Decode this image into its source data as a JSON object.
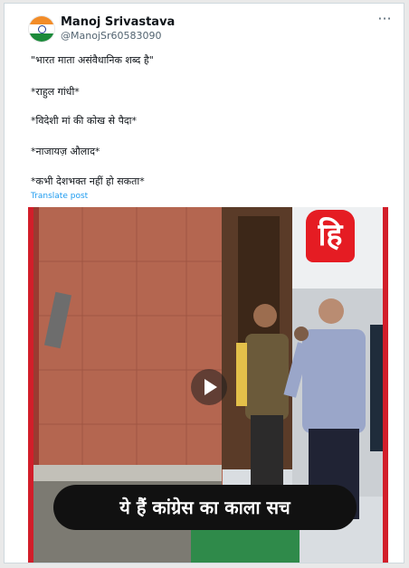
{
  "post": {
    "author_name": "Manoj Srivastava",
    "author_handle": "@ManojSr60583090",
    "lines": [
      "\"भारत माता असंवैधानिक शब्द है\"",
      "*राहुल गांधी*",
      "*विदेशी मां की कोख से पैदा*",
      "*नाजायज़ औलाद*",
      "*कभी देशभक्त नहीं हो सकता*"
    ],
    "translate_label": "Translate post",
    "more_icon": "more-horizontal-icon",
    "avatar_icon": "indian-flag-avatar"
  },
  "video": {
    "logo_text": "हि",
    "caption": "ये हैं कांग्रेस का काला सच",
    "play_icon": "play-icon"
  },
  "colors": {
    "link": "#1d9bf0",
    "text": "#0f1419",
    "secondary": "#536471",
    "logo_red": "#e51c23",
    "caption_bg": "#111111"
  }
}
